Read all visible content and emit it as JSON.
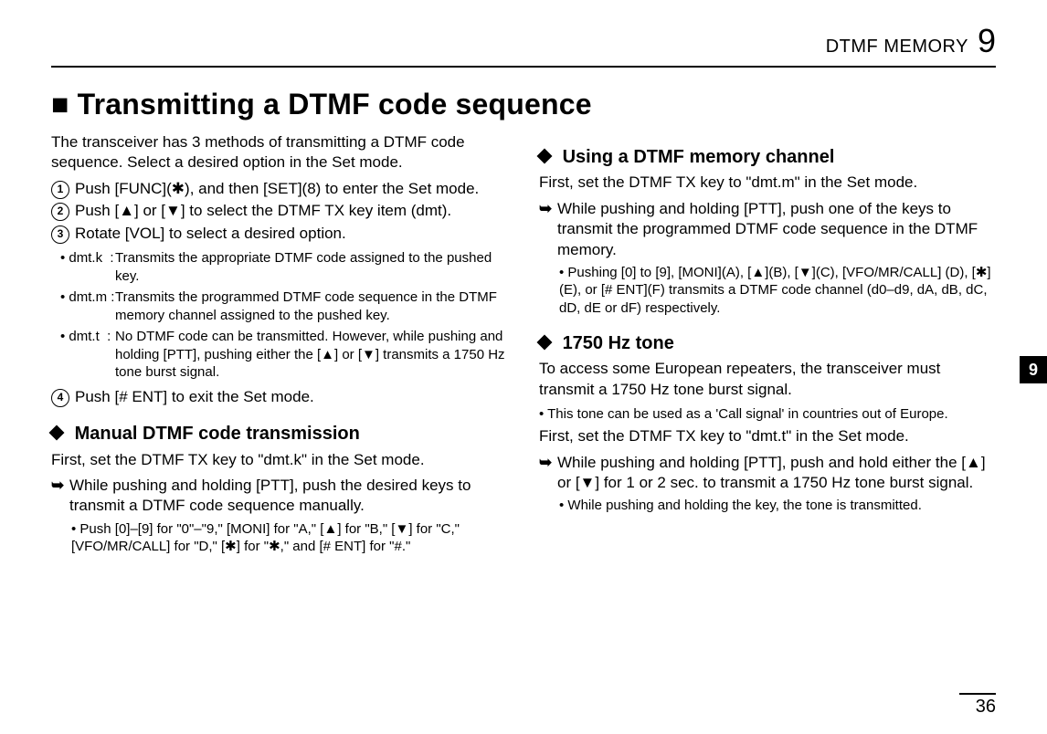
{
  "header": {
    "title": "DTMF MEMORY",
    "chapter": "9"
  },
  "title": "■ Transmitting a DTMF code sequence",
  "side_tab": "9",
  "page_number": "36",
  "left": {
    "intro": "The transceiver has 3 methods of transmitting a DTMF code sequence. Select a desired option in the Set mode.",
    "steps": [
      {
        "n": "1",
        "text": "Push [FUNC](✱), and then [SET](8) to enter the Set mode."
      },
      {
        "n": "2",
        "text": "Push [▲] or [▼] to select the DTMF TX key item (dmt)."
      },
      {
        "n": "3",
        "text": "Rotate [VOL] to select a desired option."
      }
    ],
    "options": [
      {
        "label": "• dmt.k  :",
        "text": "Transmits the appropriate DTMF code assigned to the pushed key."
      },
      {
        "label": "• dmt.m :",
        "text": "Transmits the programmed DTMF code sequence in the DTMF memory channel assigned to the pushed key."
      },
      {
        "label": "• dmt.t  :",
        "text": "No DTMF code can be transmitted. However, while pushing and holding [PTT], pushing either the [▲] or [▼] transmits a 1750 Hz tone burst signal."
      }
    ],
    "step4": {
      "n": "4",
      "text": "Push [# ENT] to exit the Set mode."
    },
    "sub1_title": "Manual DTMF code transmission",
    "sub1_text1": "First, set the DTMF TX key to \"dmt.k\" in the Set mode.",
    "sub1_arrow": "While pushing and holding [PTT], push the desired keys to transmit a DTMF code sequence manually.",
    "sub1_bullet": "• Push [0]–[9] for \"0\"–\"9,\" [MONI] for \"A,\" [▲] for \"B,\" [▼] for \"C,\" [VFO/MR/CALL] for \"D,\" [✱] for \"✱,\" and [# ENT] for \"#.\""
  },
  "right": {
    "sub2_title": "Using a DTMF memory channel",
    "sub2_text1": "First, set the DTMF TX key to \"dmt.m\" in the Set mode.",
    "sub2_arrow": "While pushing and holding [PTT], push one of the keys to transmit the programmed DTMF code sequence in the DTMF memory.",
    "sub2_bullet": "• Pushing [0] to [9], [MONI](A), [▲](B), [▼](C), [VFO/MR/CALL] (D), [✱](E), or [# ENT](F) transmits a DTMF code channel (d0–d9, dA, dB, dC, dD, dE or dF) respectively.",
    "sub3_title": "1750 Hz tone",
    "sub3_text1": "To access some European repeaters, the transceiver must transmit a 1750 Hz tone burst signal.",
    "sub3_small": "• This tone can be used as a 'Call signal' in countries out of Europe.",
    "sub3_text2": "First, set the DTMF TX key to \"dmt.t\" in the Set mode.",
    "sub3_arrow": "While pushing and holding [PTT], push and hold either the [▲] or [▼] for 1 or 2 sec. to transmit a 1750 Hz tone burst signal.",
    "sub3_bullet": "• While pushing and holding the key, the tone is transmitted."
  }
}
